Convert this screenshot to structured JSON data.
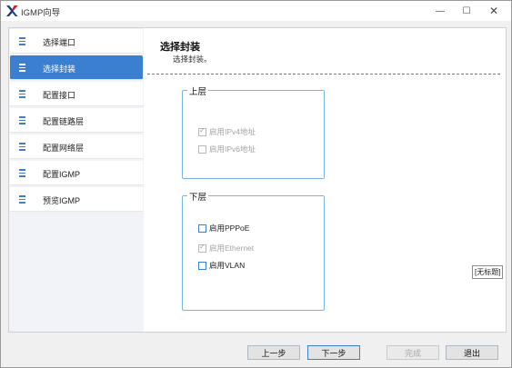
{
  "window": {
    "title": "IGMP向导",
    "controls": {
      "minimize": "—",
      "maximize": "☐",
      "close": "✕"
    }
  },
  "sidebar": {
    "items": [
      {
        "label": "选择端口",
        "active": false
      },
      {
        "label": "选择封装",
        "active": true
      },
      {
        "label": "配置接口",
        "active": false
      },
      {
        "label": "配置链路层",
        "active": false
      },
      {
        "label": "配置网络层",
        "active": false
      },
      {
        "label": "配置IGMP",
        "active": false
      },
      {
        "label": "预览IGMP",
        "active": false
      }
    ]
  },
  "main": {
    "title": "选择封装",
    "subtitle": "选择封装。",
    "upper_group": {
      "legend": "上层",
      "options": [
        {
          "label": "启用IPv4地址",
          "checked": true,
          "enabled": false
        },
        {
          "label": "启用IPv6地址",
          "checked": false,
          "enabled": false
        }
      ]
    },
    "lower_group": {
      "legend": "下层",
      "options": [
        {
          "label": "启用PPPoE",
          "checked": false,
          "enabled": true
        },
        {
          "label": "启用Ethernet",
          "checked": true,
          "enabled": false
        },
        {
          "label": "启用VLAN",
          "checked": false,
          "enabled": true
        }
      ]
    },
    "tooltip": "[无标题]"
  },
  "footer": {
    "prev": "上一步",
    "next": "下一步",
    "finish": "完成",
    "exit": "退出"
  },
  "colors": {
    "accent": "#3a7fd0",
    "group_border": "#79b6dd",
    "dash_line": "#3a8cc8",
    "brand_red": "#c8232c",
    "brand_navy": "#1a3c7a"
  }
}
